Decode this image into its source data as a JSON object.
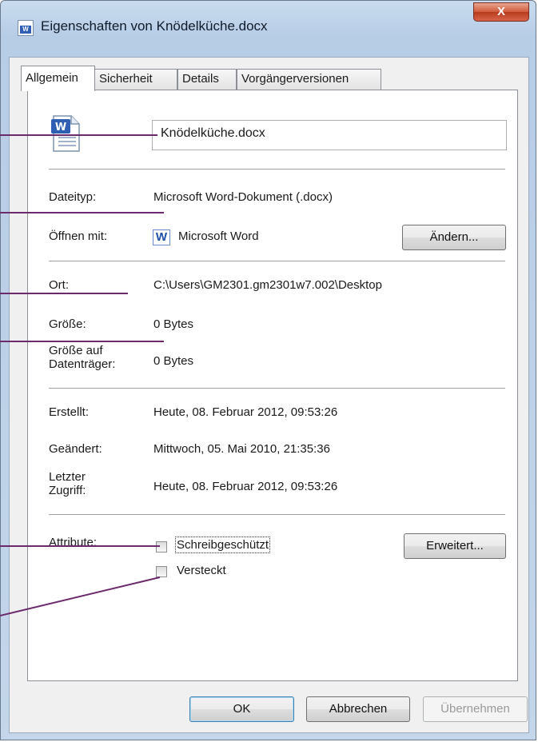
{
  "window": {
    "title": "Eigenschaften von Knödelküche.docx",
    "close_label": "X"
  },
  "tabs": [
    {
      "label": "Allgemein"
    },
    {
      "label": "Sicherheit"
    },
    {
      "label": "Details"
    },
    {
      "label": "Vorgängerversionen"
    }
  ],
  "general": {
    "filename_value": "Knödelküche.docx",
    "dateityp_label": "Dateityp:",
    "dateityp_value": "Microsoft Word-Dokument (.docx)",
    "oeffnen_label": "Öffnen mit:",
    "oeffnen_value": "Microsoft Word",
    "aendern_label": "Ändern...",
    "ort_label": "Ort:",
    "ort_value": "C:\\Users\\GM2301.gm2301w7.002\\Desktop",
    "groesse_label": "Größe:",
    "groesse_value": "0 Bytes",
    "groesse_disk_label_1": "Größe auf",
    "groesse_disk_label_2": "Datenträger:",
    "groesse_disk_value": "0 Bytes",
    "erstellt_label": "Erstellt:",
    "erstellt_value": "Heute, 08. Februar 2012, 09:53:26",
    "geaendert_label": "Geändert:",
    "geaendert_value": "Mittwoch, 05. Mai 2010, 21:35:36",
    "zugriff_label_1": "Letzter",
    "zugriff_label_2": "Zugriff:",
    "zugriff_value": "Heute, 08. Februar 2012, 09:53:26",
    "attribute_label": "Attribute:",
    "schreibgeschuetzt_label": "Schreibgeschützt",
    "schreibgeschuetzt_checked": false,
    "versteckt_label": "Versteckt",
    "versteckt_checked": false,
    "erweitert_label": "Erweitert..."
  },
  "footer": {
    "ok_label": "OK",
    "abbrechen_label": "Abbrechen",
    "uebernehmen_label": "Übernehmen"
  },
  "colors": {
    "callout_line": "#6b2a6b",
    "word_blue": "#2f5fb3"
  },
  "icons": {
    "title": "word-document-icon",
    "file": "word-document-icon",
    "app": "microsoft-word-icon"
  }
}
